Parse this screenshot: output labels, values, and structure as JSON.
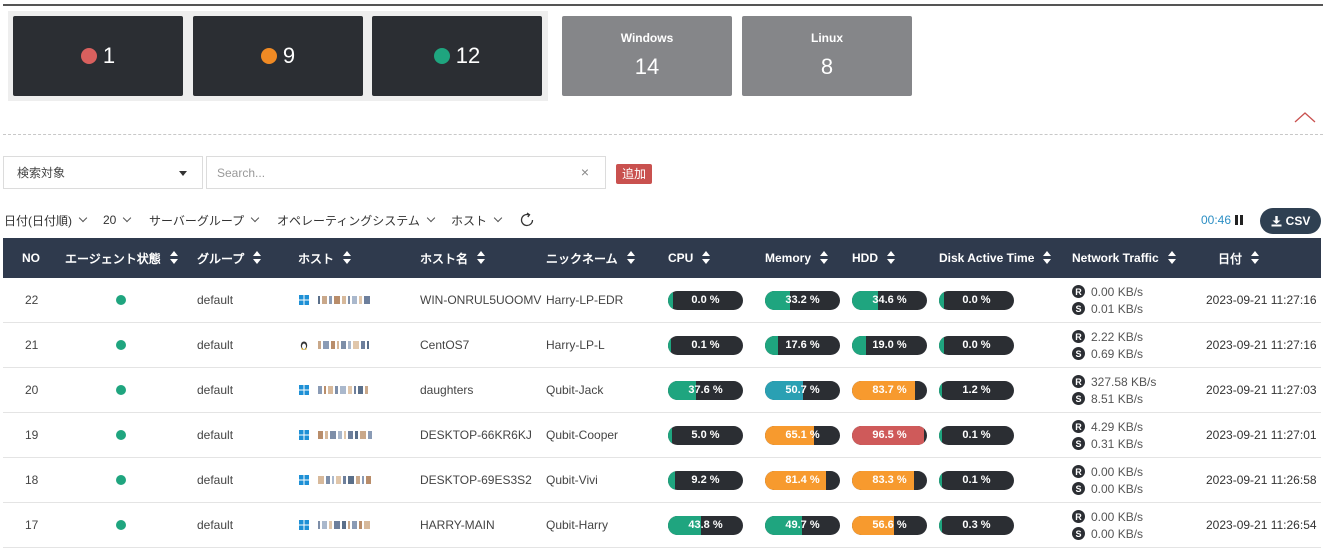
{
  "status_cards": [
    {
      "count": "1",
      "color": "#d9605e"
    },
    {
      "count": "9",
      "color": "#f08a24"
    },
    {
      "count": "12",
      "color": "#1fa57f"
    }
  ],
  "os_cards": [
    {
      "name": "Windows",
      "count": "14"
    },
    {
      "name": "Linux",
      "count": "8"
    }
  ],
  "search": {
    "target_label": "検索対象",
    "placeholder": "Search...",
    "clear_icon": "×",
    "add_label": "追加"
  },
  "filters": {
    "date": "日付(日付順)",
    "page_size": "20",
    "server_group": "サーバーグループ",
    "os": "オペレーティングシステム",
    "host": "ホスト"
  },
  "timer": "00:46",
  "csv_label": "CSV",
  "colors": {
    "green": "#1fa57f",
    "orange": "#f79a2e",
    "red": "#cf5a5a",
    "teal": "#2aa0b3",
    "dark": "#2b2e33",
    "header": "#2f3a4d"
  },
  "table": {
    "headers": {
      "no": "NO",
      "agent": "エージェント状態",
      "group": "グループ",
      "host": "ホスト",
      "hostname": "ホスト名",
      "nickname": "ニックネーム",
      "cpu": "CPU",
      "memory": "Memory",
      "hdd": "HDD",
      "disk": "Disk Active Time",
      "network": "Network Traffic",
      "date": "日付"
    },
    "rows": [
      {
        "no": "22",
        "group": "default",
        "os": "windows",
        "hostname": "WIN-ONRUL5UOOMV",
        "nickname": "Harry-LP-EDR",
        "cpu": {
          "label": "0.0 %",
          "pct": 0,
          "color": "#1fa57f"
        },
        "memory": {
          "label": "33.2 %",
          "pct": 33.2,
          "color": "#1fa57f"
        },
        "hdd": {
          "label": "34.6 %",
          "pct": 34.6,
          "color": "#1fa57f"
        },
        "disk": {
          "label": "0.0 %",
          "pct": 0,
          "color": "#1fa57f"
        },
        "net_r": "0.00 KB/s",
        "net_s": "0.01 KB/s",
        "date": "2023-09-21 11:27:16"
      },
      {
        "no": "21",
        "group": "default",
        "os": "linux",
        "hostname": "CentOS7",
        "nickname": "Harry-LP-L",
        "cpu": {
          "label": "0.1 %",
          "pct": 0.1,
          "color": "#1fa57f"
        },
        "memory": {
          "label": "17.6 %",
          "pct": 17.6,
          "color": "#1fa57f"
        },
        "hdd": {
          "label": "19.0 %",
          "pct": 19.0,
          "color": "#1fa57f"
        },
        "disk": {
          "label": "0.0 %",
          "pct": 0,
          "color": "#1fa57f"
        },
        "net_r": "2.22 KB/s",
        "net_s": "0.69 KB/s",
        "date": "2023-09-21 11:27:16"
      },
      {
        "no": "20",
        "group": "default",
        "os": "windows",
        "hostname": "daughters",
        "nickname": "Qubit-Jack",
        "cpu": {
          "label": "37.6 %",
          "pct": 37.6,
          "color": "#1fa57f"
        },
        "memory": {
          "label": "50.7 %",
          "pct": 50.7,
          "color": "#2aa0b3"
        },
        "hdd": {
          "label": "83.7 %",
          "pct": 83.7,
          "color": "#f79a2e"
        },
        "disk": {
          "label": "1.2 %",
          "pct": 1.2,
          "color": "#1fa57f"
        },
        "net_r": "327.58 KB/s",
        "net_s": "8.51 KB/s",
        "date": "2023-09-21 11:27:03"
      },
      {
        "no": "19",
        "group": "default",
        "os": "windows",
        "hostname": "DESKTOP-66KR6KJ",
        "nickname": "Qubit-Cooper",
        "cpu": {
          "label": "5.0 %",
          "pct": 5.0,
          "color": "#1fa57f"
        },
        "memory": {
          "label": "65.1 %",
          "pct": 65.1,
          "color": "#f79a2e"
        },
        "hdd": {
          "label": "96.5 %",
          "pct": 96.5,
          "color": "#cf5a5a"
        },
        "disk": {
          "label": "0.1 %",
          "pct": 0.1,
          "color": "#1fa57f"
        },
        "net_r": "4.29 KB/s",
        "net_s": "0.31 KB/s",
        "date": "2023-09-21 11:27:01"
      },
      {
        "no": "18",
        "group": "default",
        "os": "windows",
        "hostname": "DESKTOP-69ES3S2",
        "nickname": "Qubit-Vivi",
        "cpu": {
          "label": "9.2 %",
          "pct": 9.2,
          "color": "#1fa57f"
        },
        "memory": {
          "label": "81.4 %",
          "pct": 81.4,
          "color": "#f79a2e"
        },
        "hdd": {
          "label": "83.3 %",
          "pct": 83.3,
          "color": "#f79a2e"
        },
        "disk": {
          "label": "0.1 %",
          "pct": 0.1,
          "color": "#1fa57f"
        },
        "net_r": "0.00 KB/s",
        "net_s": "0.00 KB/s",
        "date": "2023-09-21 11:26:58"
      },
      {
        "no": "17",
        "group": "default",
        "os": "windows",
        "hostname": "HARRY-MAIN",
        "nickname": "Qubit-Harry",
        "cpu": {
          "label": "43.8 %",
          "pct": 43.8,
          "color": "#1fa57f"
        },
        "memory": {
          "label": "49.7 %",
          "pct": 49.7,
          "color": "#1fa57f"
        },
        "hdd": {
          "label": "56.6 %",
          "pct": 56.6,
          "color": "#f79a2e"
        },
        "disk": {
          "label": "0.3 %",
          "pct": 0.3,
          "color": "#1fa57f"
        },
        "net_r": "0.00 KB/s",
        "net_s": "0.00 KB/s",
        "date": "2023-09-21 11:26:54"
      }
    ]
  }
}
